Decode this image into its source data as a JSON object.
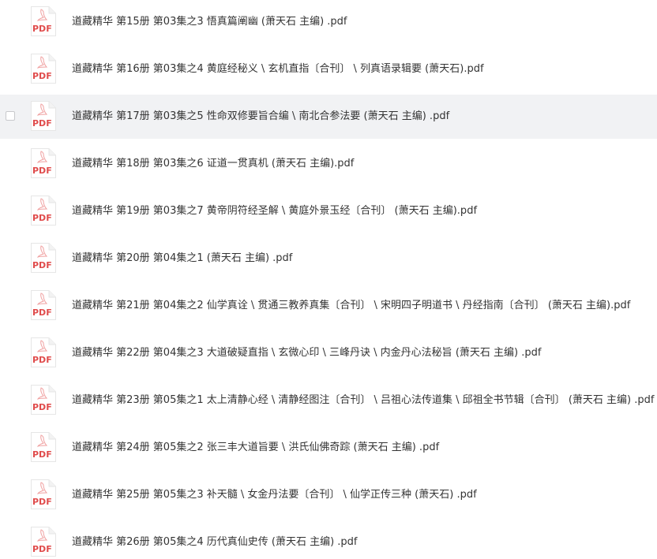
{
  "colors": {
    "pdf_red": "#e04c4c",
    "text": "#333333",
    "hover_bg": "#f1f2f4"
  },
  "files": [
    {
      "name": "道藏精华 第15册 第03集之3 悟真篇阐幽 (萧天石 主编) .pdf",
      "icon": "pdf-icon",
      "icon_label": "PDF"
    },
    {
      "name": "道藏精华 第16册 第03集之4 黄庭经秘义 \\ 玄机直指〔合刊〕 \\ 列真语录辑要 (萧天石).pdf",
      "icon": "pdf-icon",
      "icon_label": "PDF"
    },
    {
      "name": "道藏精华 第17册 第03集之5 性命双修要旨合编 \\ 南北合参法要 (萧天石 主编) .pdf",
      "icon": "pdf-icon",
      "icon_label": "PDF",
      "hovered": true
    },
    {
      "name": "道藏精华 第18册 第03集之6 证道一贯真机 (萧天石 主编).pdf",
      "icon": "pdf-icon",
      "icon_label": "PDF"
    },
    {
      "name": "道藏精华 第19册 第03集之7 黄帝阴符经圣解 \\ 黄庭外景玉经〔合刊〕 (萧天石 主编).pdf",
      "icon": "pdf-icon",
      "icon_label": "PDF"
    },
    {
      "name": "道藏精华 第20册 第04集之1 (萧天石 主编) .pdf",
      "icon": "pdf-icon",
      "icon_label": "PDF"
    },
    {
      "name": "道藏精华 第21册 第04集之2 仙学真诠 \\ 贯通三教养真集〔合刊〕 \\ 宋明四子明道书 \\ 丹经指南〔合刊〕 (萧天石 主编).pdf",
      "icon": "pdf-icon",
      "icon_label": "PDF"
    },
    {
      "name": "道藏精华 第22册 第04集之3 大道破疑直指 \\ 玄微心印 \\ 三峰丹诀 \\ 内金丹心法秘旨 (萧天石 主编) .pdf",
      "icon": "pdf-icon",
      "icon_label": "PDF"
    },
    {
      "name": "道藏精华 第23册 第05集之1 太上清静心经 \\ 清静经图注〔合刊〕 \\ 吕祖心法传道集 \\ 邱祖全书节辑〔合刊〕 (萧天石 主编) .pdf",
      "icon": "pdf-icon",
      "icon_label": "PDF"
    },
    {
      "name": "道藏精华 第24册 第05集之2 张三丰大道旨要 \\ 洪氏仙佛奇踪 (萧天石 主编) .pdf",
      "icon": "pdf-icon",
      "icon_label": "PDF"
    },
    {
      "name": "道藏精华 第25册 第05集之3 补天髓 \\ 女金丹法要〔合刊〕 \\ 仙学正传三种 (萧天石) .pdf",
      "icon": "pdf-icon",
      "icon_label": "PDF"
    },
    {
      "name": "道藏精华 第26册 第05集之4 历代真仙史传 (萧天石 主编) .pdf",
      "icon": "pdf-icon",
      "icon_label": "PDF"
    }
  ]
}
